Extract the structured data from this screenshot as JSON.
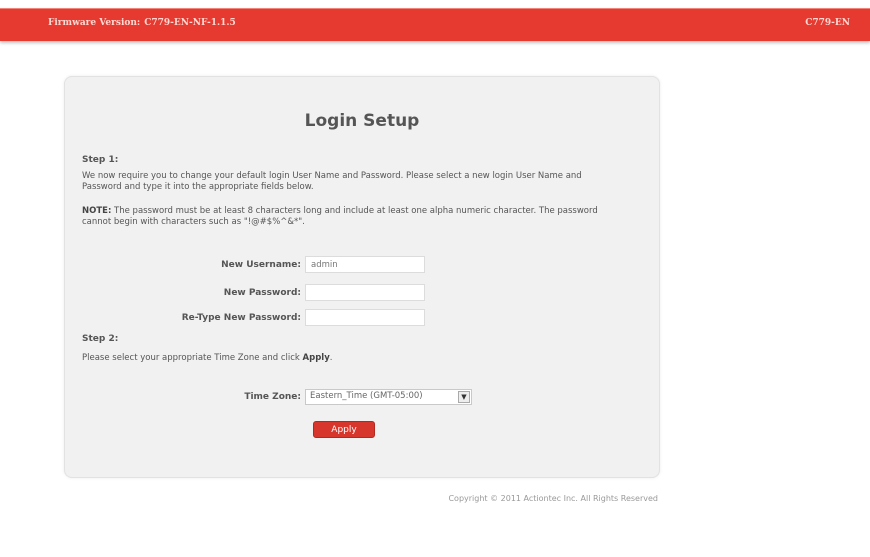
{
  "header": {
    "firmware_label": "Firmware Version:",
    "firmware_value": "C779-EN-NF-1.1.5",
    "model": "C779-EN"
  },
  "panel": {
    "title": "Login Setup",
    "step1_heading": "Step 1:",
    "step1_text": "We now require you to change your default login User Name and Password. Please select a new login User Name and Password and type it into the appropriate fields below.",
    "note_label": "NOTE:",
    "note_text": " The password must be at least 8 characters long and include at least one alpha numeric character. The password cannot begin with characters such as \"!@#$%^&*\".",
    "username_label": "New Username:",
    "username_value": "admin",
    "password_label": "New Password:",
    "password_value": "",
    "retype_label": "Re-Type New Password:",
    "retype_value": "",
    "step2_heading": "Step 2:",
    "step2_text_before": "Please select your appropriate Time Zone and click ",
    "step2_text_apply": "Apply",
    "step2_text_after": ".",
    "timezone_label": "Time Zone:",
    "timezone_value": "Eastern_Time (GMT-05:00)",
    "apply_label": "Apply"
  },
  "footer": {
    "copyright": "Copyright © 2011 Actiontec Inc. All Rights Reserved"
  }
}
